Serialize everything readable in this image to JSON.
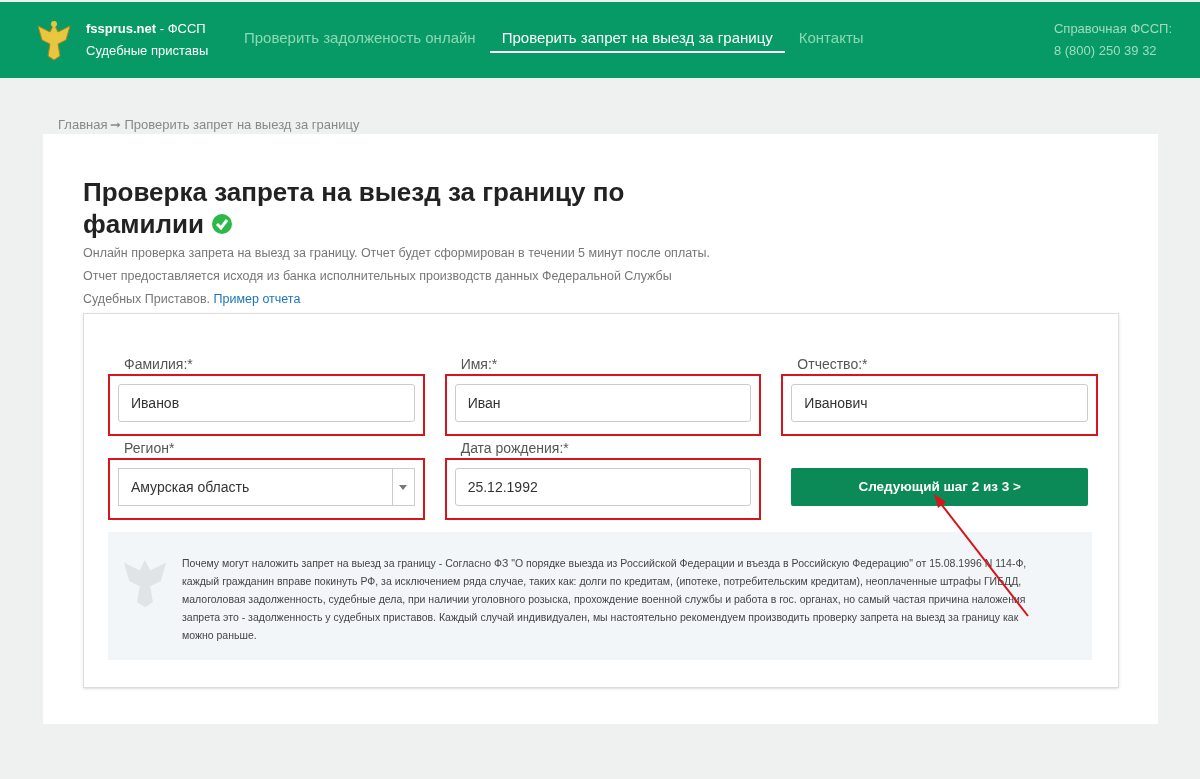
{
  "header": {
    "brand": "fssprus.net",
    "brand_suffix": "- ФССП",
    "subtitle": "Судебные приставы",
    "nav": [
      {
        "label": "Проверить задолженость онлайн",
        "selected": false
      },
      {
        "label": "Проверить запрет на выезд за границу",
        "selected": true
      },
      {
        "label": "Контакты",
        "selected": false
      }
    ],
    "help_label": "Справочная ФССП:",
    "help_phone": "8 (800) 250 39 32"
  },
  "breadcrumb": {
    "home": "Главная",
    "separator": "➞",
    "current": "Проверить запрет на выезд за границу"
  },
  "title": "Проверка запрета на выезд за границу по фамилии",
  "title_verified": true,
  "description": "Онлайн проверка запрета на выезд за границу. Отчет будет сформирован в течении 5 минут после оплаты. Отчет предоставляется исходя из банка исполнительных производств данных Федеральной Службы Судебных Приставов.",
  "sample_link": "Пример отчета",
  "fields": [
    {
      "kind": "text",
      "label": "Фамилия:*",
      "value": "Иванов",
      "highlighted": true
    },
    {
      "kind": "text",
      "label": "Имя:*",
      "value": "Иван",
      "highlighted": true
    },
    {
      "kind": "text",
      "label": "Отчество:*",
      "value": "Иванович",
      "highlighted": true
    },
    {
      "kind": "select",
      "label": "Регион*",
      "value": "Амурская область",
      "highlighted": true
    },
    {
      "kind": "text",
      "label": "Дата рождения:*",
      "value": "25.12.1992",
      "highlighted": true
    }
  ],
  "next_button": {
    "label": "Следующий шаг 2 из 3 >",
    "arrow_annotation": true
  },
  "info": "Почему могут наложить запрет на выезд за границу - Согласно ФЗ \"О порядке выезда из Российской Федерации и въезда в Российскую Федерацию\" от 15.08.1996 N 114-Ф, каждый гражданин вправе покинуть РФ, за исключением ряда случае, таких как: долги по кредитам, (ипотеке, потребительским кредитам), неоплаченные штрафы ГИБДД, малоголовая задолженность, судебные дела, при наличии уголовного розыска, прохождение военной службы и работа в гос. органах, но самый частая причина наложения запрета это - задолженность у судебных приставов. Каждый случай индивидуален, мы настоятельно рекомендуем производить проверку запрета на выезд за границу как можно раньше."
}
